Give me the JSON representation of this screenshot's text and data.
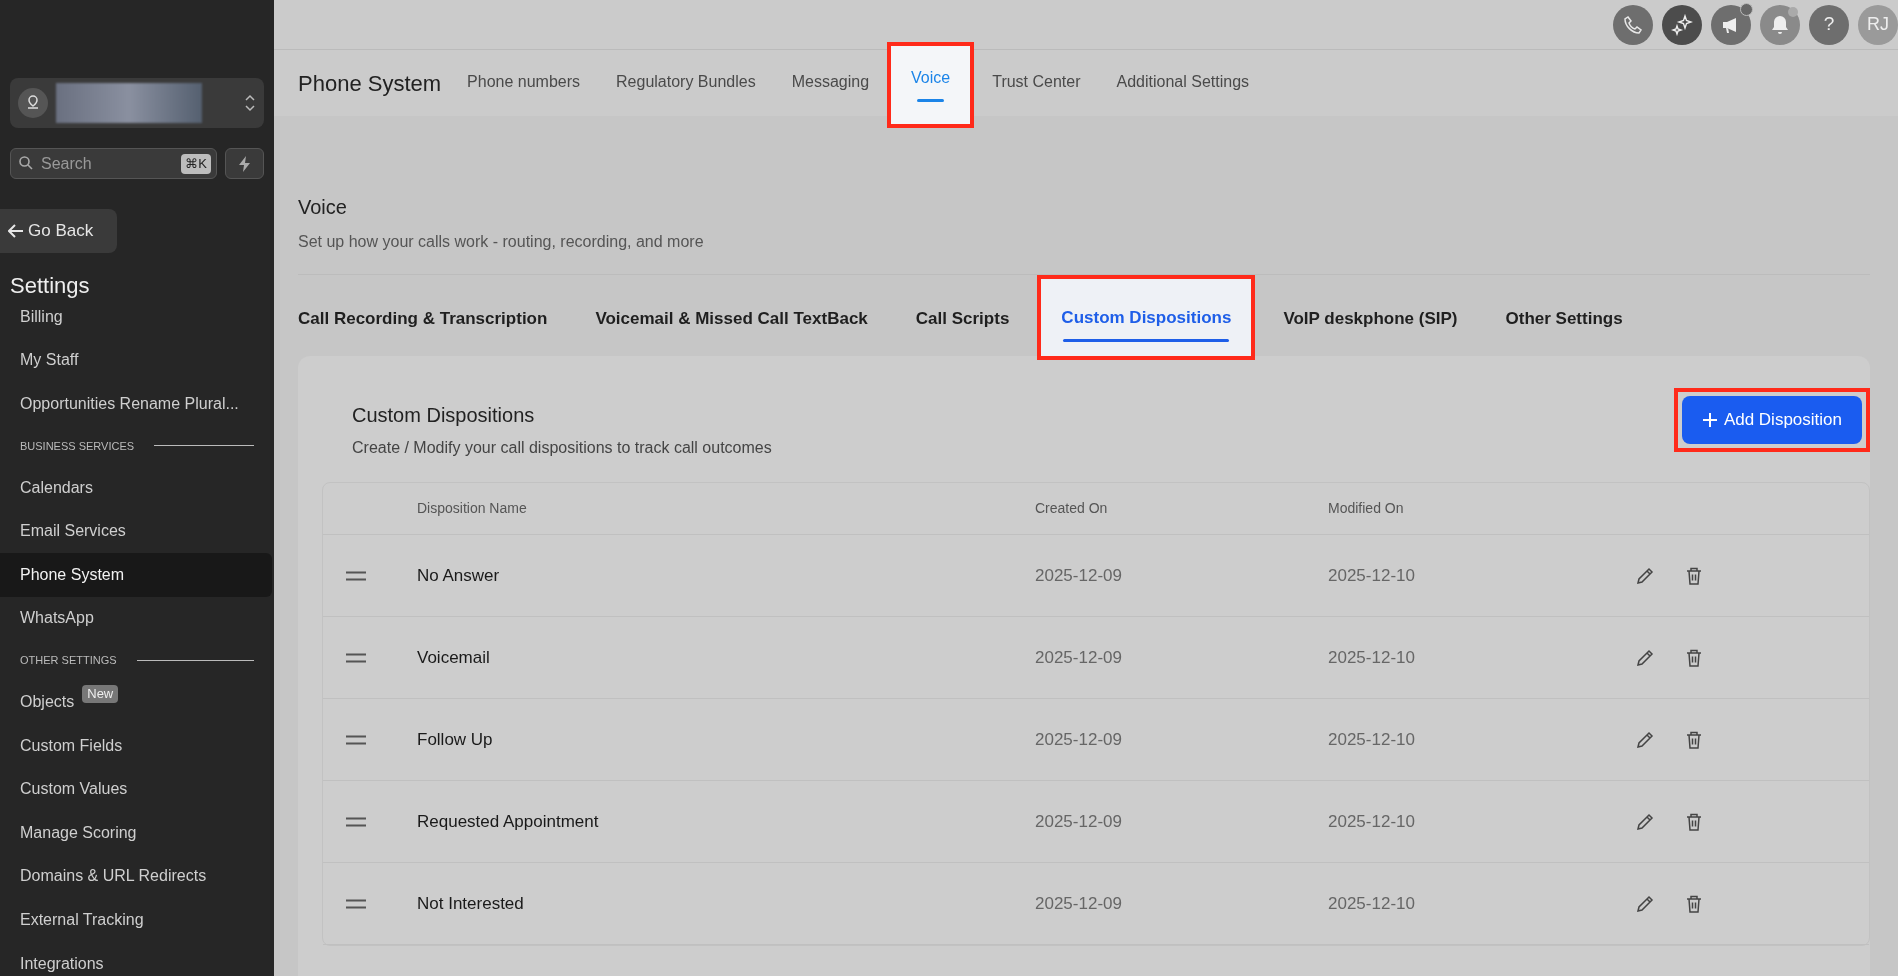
{
  "top_bar": {
    "help": "?",
    "avatar": "RJ"
  },
  "sidebar": {
    "search_placeholder": "Search",
    "shortcut": "⌘K",
    "back": "Go Back",
    "title": "Settings",
    "items": [
      {
        "kind": "item",
        "label": "Billing",
        "selected": false
      },
      {
        "kind": "item",
        "label": "My Staff",
        "selected": false
      },
      {
        "kind": "item",
        "label": "Opportunities Rename Plural...",
        "selected": false
      },
      {
        "kind": "section",
        "label": "BUSINESS SERVICES"
      },
      {
        "kind": "item",
        "label": "Calendars",
        "selected": false
      },
      {
        "kind": "item",
        "label": "Email Services",
        "selected": false
      },
      {
        "kind": "item",
        "label": "Phone System",
        "selected": true
      },
      {
        "kind": "item",
        "label": "WhatsApp",
        "selected": false
      },
      {
        "kind": "section",
        "label": "OTHER SETTINGS"
      },
      {
        "kind": "item",
        "label": "Objects",
        "selected": false,
        "badge": "New"
      },
      {
        "kind": "item",
        "label": "Custom Fields",
        "selected": false
      },
      {
        "kind": "item",
        "label": "Custom Values",
        "selected": false
      },
      {
        "kind": "item",
        "label": "Manage Scoring",
        "selected": false
      },
      {
        "kind": "item",
        "label": "Domains & URL Redirects",
        "selected": false
      },
      {
        "kind": "item",
        "label": "External Tracking",
        "selected": false
      },
      {
        "kind": "item",
        "label": "Integrations",
        "selected": false
      }
    ]
  },
  "header": {
    "title": "Phone System",
    "tabs": [
      {
        "label": "Phone numbers",
        "selected": false,
        "annotated": false
      },
      {
        "label": "Regulatory Bundles",
        "selected": false,
        "annotated": false
      },
      {
        "label": "Messaging",
        "selected": false,
        "annotated": false
      },
      {
        "label": "Voice",
        "selected": true,
        "annotated": true
      },
      {
        "label": "Trust Center",
        "selected": false,
        "annotated": false
      },
      {
        "label": "Additional Settings",
        "selected": false,
        "annotated": false
      }
    ]
  },
  "voice": {
    "title": "Voice",
    "subtitle": "Set up how your calls work - routing, recording, and more",
    "tabs": [
      {
        "label": "Call Recording & Transcription",
        "selected": false,
        "annotated": false
      },
      {
        "label": "Voicemail & Missed Call TextBack",
        "selected": false,
        "annotated": false
      },
      {
        "label": "Call Scripts",
        "selected": false,
        "annotated": false
      },
      {
        "label": "Custom Dispositions",
        "selected": true,
        "annotated": true
      },
      {
        "label": "VoIP deskphone (SIP)",
        "selected": false,
        "annotated": false
      },
      {
        "label": "Other Settings",
        "selected": false,
        "annotated": false
      }
    ]
  },
  "card": {
    "title": "Custom Dispositions",
    "subtitle": "Create / Modify your call dispositions to track call outcomes",
    "add_button": {
      "label": "Add Disposition",
      "annotated": true
    },
    "columns": [
      "Disposition Name",
      "Created On",
      "Modified On"
    ],
    "rows": [
      {
        "name": "No Answer",
        "created": "2025-12-09",
        "modified": "2025-12-10"
      },
      {
        "name": "Voicemail",
        "created": "2025-12-09",
        "modified": "2025-12-10"
      },
      {
        "name": "Follow Up",
        "created": "2025-12-09",
        "modified": "2025-12-10"
      },
      {
        "name": "Requested Appointment",
        "created": "2025-12-09",
        "modified": "2025-12-10"
      },
      {
        "name": "Not Interested",
        "created": "2025-12-09",
        "modified": "2025-12-10"
      }
    ]
  }
}
